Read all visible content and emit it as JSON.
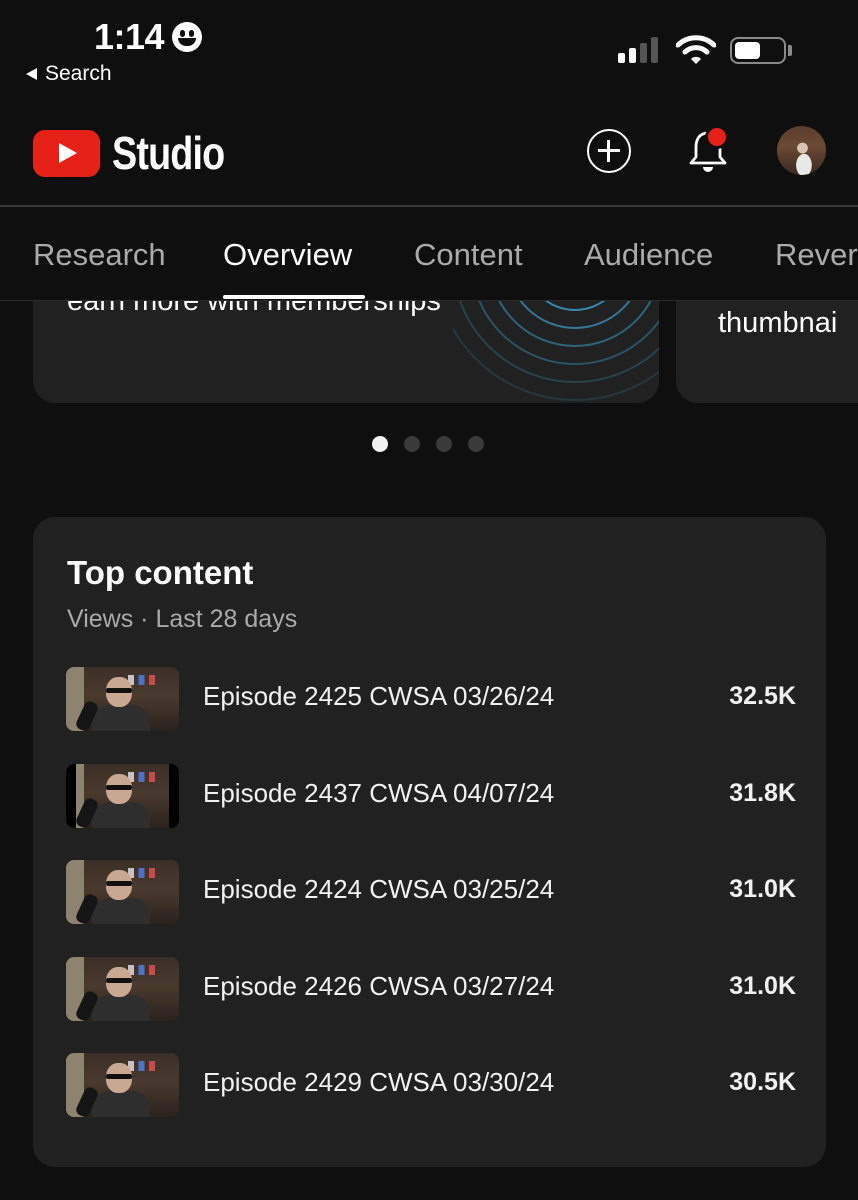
{
  "status_bar": {
    "time": "1:14",
    "emoji_icon": "grinning-face-icon",
    "back_label": "Search",
    "signal_bars_active": 2,
    "signal_bars_total": 4,
    "battery_level": 0.55
  },
  "header": {
    "app_name": "Studio",
    "icons": [
      "create-icon",
      "notifications-bell-icon",
      "account-avatar"
    ],
    "notification_badge_color": "#e62117",
    "brand_color": "#e62117"
  },
  "tabs": [
    {
      "label": "Research",
      "active": false
    },
    {
      "label": "Overview",
      "active": true
    },
    {
      "label": "Content",
      "active": false
    },
    {
      "label": "Audience",
      "active": false
    },
    {
      "label": "Rever",
      "active": false
    }
  ],
  "carousel": {
    "cards": [
      {
        "title": "earn more with memberships"
      },
      {
        "title": "thumbnai"
      }
    ],
    "page_count": 4,
    "active_index": 0
  },
  "top_content": {
    "title": "Top content",
    "subtitle": "Views · Last 28 days",
    "items": [
      {
        "title": "Episode 2425 CWSA 03/26/24",
        "views": "32.5K"
      },
      {
        "title": "Episode 2437 CWSA 04/07/24",
        "views": "31.8K"
      },
      {
        "title": "Episode 2424 CWSA 03/25/24",
        "views": "31.0K"
      },
      {
        "title": "Episode 2426 CWSA 03/27/24",
        "views": "31.0K"
      },
      {
        "title": "Episode 2429 CWSA 03/30/24",
        "views": "30.5K"
      }
    ]
  }
}
